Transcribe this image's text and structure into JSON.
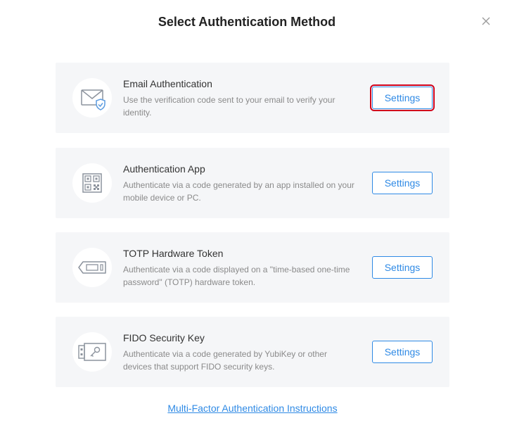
{
  "dialog": {
    "title": "Select Authentication Method",
    "close_icon": "close-icon"
  },
  "methods": [
    {
      "name": "Email Authentication",
      "description": "Use the verification code sent to your email to verify your identity.",
      "button_label": "Settings",
      "icon": "envelope-shield-icon",
      "focused": true
    },
    {
      "name": "Authentication App",
      "description": "Authenticate via a code generated by an app installed on your mobile device or PC.",
      "button_label": "Settings",
      "icon": "qr-code-icon",
      "focused": false
    },
    {
      "name": "TOTP Hardware Token",
      "description": "Authenticate via a code displayed on a \"time-based one-time password\" (TOTP) hardware token.",
      "button_label": "Settings",
      "icon": "hardware-token-icon",
      "focused": false
    },
    {
      "name": "FIDO Security Key",
      "description": "Authenticate via a code generated by YubiKey or other devices that support FIDO security keys.",
      "button_label": "Settings",
      "icon": "security-key-icon",
      "focused": false
    }
  ],
  "footer": {
    "link_text": "Multi-Factor Authentication Instructions"
  },
  "colors": {
    "accent": "#2f8ae5",
    "focus_outline": "#d0021b",
    "card_background": "#f5f6f8",
    "icon_stroke": "#8c939d",
    "shield_color": "#5b9be0"
  }
}
